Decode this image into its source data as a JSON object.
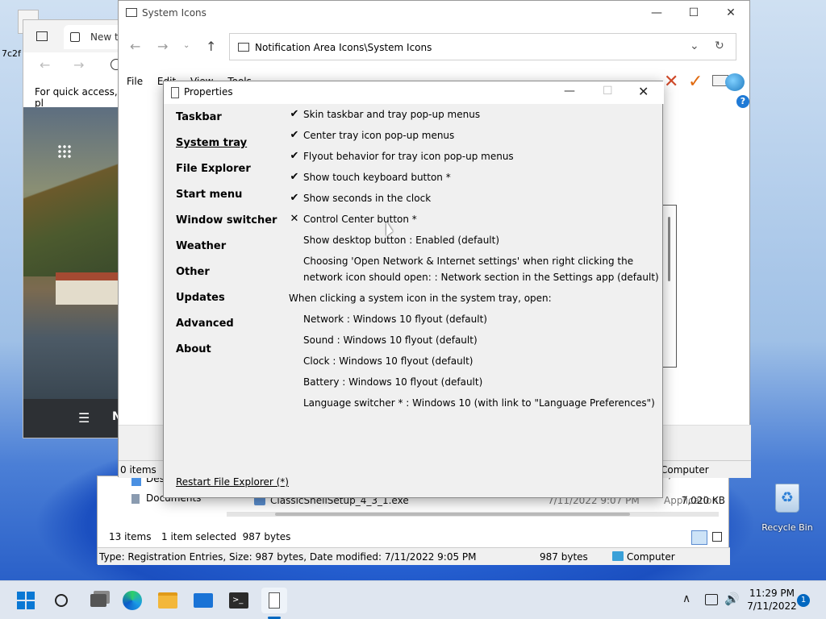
{
  "desktop": {
    "top_left_label": "7c2f",
    "recycle_bin_label": "Recycle Bin"
  },
  "browser": {
    "tab_label": "New ta",
    "quick_access_text": "For quick access, pl",
    "page_text": "N"
  },
  "explorer_back": {
    "row1_name": "ClassicShellSetup_4_3_1.exe",
    "row1_date": "7/11/2022 9:07 PM",
    "row1_type": "Application",
    "row1_size": "7,020 KB",
    "row0_size": "7,020 KB",
    "sidebar_desktop": "Desk",
    "sidebar_documents": "Documents",
    "status_items": "13 items",
    "status_selected": "1 item selected  987 bytes",
    "status_detail": "Type: Registration Entries, Size: 987 bytes, Date modified: 7/11/2022 9:05 PM",
    "status_bytes": "987 bytes",
    "status_computer": "Computer"
  },
  "explorer": {
    "title": "System Icons",
    "address": "Notification Area Icons\\System Icons",
    "menu": [
      "File",
      "Edit",
      "View",
      "Tools"
    ],
    "status_items": "0 items",
    "status_computer": "Computer"
  },
  "properties": {
    "title": "Properties",
    "nav": [
      "Taskbar",
      "System tray",
      "File Explorer",
      "Start menu",
      "Window switcher",
      "Weather",
      "Other",
      "Updates",
      "Advanced",
      "About"
    ],
    "options": [
      {
        "mark": "✔",
        "text": "Skin taskbar and tray pop-up menus"
      },
      {
        "mark": "✔",
        "text": "Center tray icon pop-up menus"
      },
      {
        "mark": "✔",
        "text": "Flyout behavior for tray icon pop-up menus"
      },
      {
        "mark": "✔",
        "text": "Show touch keyboard button *"
      },
      {
        "mark": "✔",
        "text": "Show seconds in the clock"
      },
      {
        "mark": "✕",
        "text": "Control Center button *"
      },
      {
        "mark": "",
        "text": "Show desktop button : Enabled (default)"
      }
    ],
    "network_line1": "Choosing 'Open Network & Internet settings' when right clicking the",
    "network_line2": "network icon should open: : Network section in the Settings app (default)",
    "section_heading": "When clicking a system icon in the system tray, open:",
    "flyouts": [
      "Network : Windows 10 flyout (default)",
      "Sound : Windows 10 flyout (default)",
      "Clock : Windows 10 flyout (default)",
      "Battery : Windows 10 flyout (default)",
      "Language switcher * : Windows 10 (with link to \"Language Preferences\")"
    ],
    "restart_link": "Restart File Explorer (*)"
  },
  "taskbar": {
    "time": "11:29 PM",
    "date": "7/11/2022",
    "notification_count": "1"
  },
  "colors": {
    "accent": "#0067c0",
    "taskbar": "#dfe6f0",
    "dialog": "#f0f0f0"
  }
}
